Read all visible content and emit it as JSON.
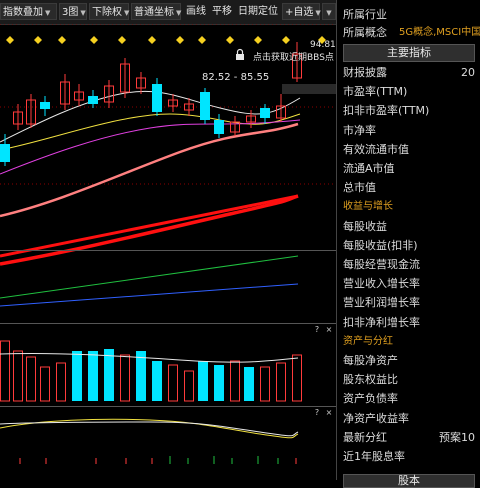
{
  "toolbar": {
    "items": [
      {
        "label": "指数叠加",
        "dropdown": true
      },
      {
        "label": "3图",
        "dropdown": true
      },
      {
        "label": "下除权",
        "dropdown": true
      },
      {
        "label": "普通坐标",
        "dropdown": true
      },
      {
        "label": "画线",
        "dropdown": false
      },
      {
        "label": "平移",
        "dropdown": false
      },
      {
        "label": "日期定位",
        "dropdown": false
      },
      {
        "label": "+自选",
        "dropdown": true
      }
    ],
    "arrow_glyph": "▼",
    "scroll_down_glyph": "▼"
  },
  "price_panel": {
    "high_price": "94.81",
    "range_label": "82.52 - 85.55",
    "bbs_hint": "点击获取近期BBS点",
    "lock_icon": "lock-icon"
  },
  "panel_icons": {
    "help": "?",
    "close": "×"
  },
  "right_panel": {
    "industry_label": "所属行业",
    "concept_label": "所属概念",
    "concept_value": "5G概念,MSCI中国",
    "main_button": "主要指标",
    "items": [
      {
        "label": "财报披露",
        "value": "20",
        "section": false
      },
      {
        "label": "市盈率(TTM)",
        "value": "",
        "section": false
      },
      {
        "label": "扣非市盈率(TTM)",
        "value": "",
        "section": false
      },
      {
        "label": "市净率",
        "value": "",
        "section": false
      },
      {
        "label": "有效流通市值",
        "value": "",
        "section": false
      },
      {
        "label": "流通A市值",
        "value": "",
        "section": false
      },
      {
        "label": "总市值",
        "value": "",
        "section": false
      },
      {
        "label": "收益与增长",
        "value": "",
        "section": true
      },
      {
        "label": "每股收益",
        "value": "",
        "section": false
      },
      {
        "label": "每股收益(扣非)",
        "value": "",
        "section": false
      },
      {
        "label": "每股经营现金流",
        "value": "",
        "section": false
      },
      {
        "label": "营业收入增长率",
        "value": "",
        "section": false
      },
      {
        "label": "营业利润增长率",
        "value": "",
        "section": false
      },
      {
        "label": "扣非净利增长率",
        "value": "",
        "section": false
      },
      {
        "label": "资产与分红",
        "value": "",
        "section": true
      },
      {
        "label": "每股净资产",
        "value": "",
        "section": false
      },
      {
        "label": "股东权益比",
        "value": "",
        "section": false
      },
      {
        "label": "资产负债率",
        "value": "",
        "section": false
      },
      {
        "label": "净资产收益率",
        "value": "",
        "section": false
      },
      {
        "label": "最新分红",
        "value": "预案10",
        "section": false
      },
      {
        "label": "近1年股息率",
        "value": "",
        "section": false
      }
    ],
    "bottom_button": "股本"
  },
  "colors": {
    "up": "#ff3b3b",
    "down": "#00e5ff",
    "ma_white": "#e8e8e8",
    "ma_yellow": "#f0e040",
    "ma_magenta": "#e040e0",
    "ma_pink": "#ff8080",
    "ma_red": "#ff1010",
    "green_line": "#20c040",
    "blue_line": "#3060ff",
    "diamond": "#f5d020"
  }
}
